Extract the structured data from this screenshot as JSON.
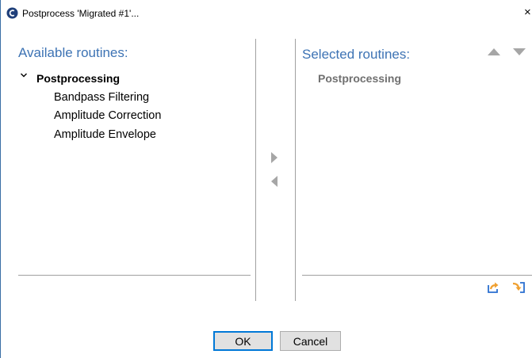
{
  "window": {
    "title": "Postprocess 'Migrated #1'...",
    "close_glyph": "×"
  },
  "available": {
    "heading": "Available routines:",
    "root": "Postprocessing",
    "items": [
      "Bandpass Filtering",
      "Amplitude Correction",
      "Amplitude Envelope"
    ]
  },
  "selected": {
    "heading": "Selected routines:",
    "items": [
      "Postprocessing"
    ]
  },
  "buttons": {
    "ok": "OK",
    "cancel": "Cancel"
  },
  "icons": {
    "app": "app-logo-icon",
    "expand": "chevron-down-icon",
    "add": "arrow-right-icon",
    "remove": "arrow-left-icon",
    "move_up": "arrow-up-icon",
    "move_down": "arrow-down-icon",
    "export": "export-icon",
    "import": "import-icon"
  },
  "colors": {
    "heading": "#3d73b4",
    "arrows": "#a6a6a6",
    "selected_item": "#707070",
    "icon_accent": "#f0a030",
    "icon_blue": "#2a6fd0"
  }
}
